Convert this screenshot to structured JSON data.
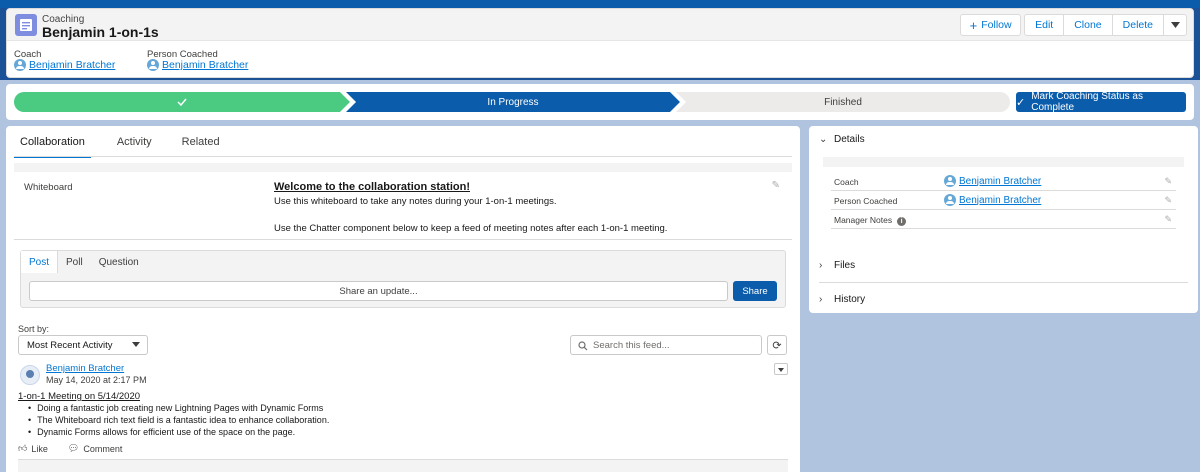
{
  "header": {
    "object_type": "Coaching",
    "title": "Benjamin 1-on-1s",
    "follow_label": "Follow",
    "actions": [
      "Edit",
      "Clone",
      "Delete"
    ],
    "fields": [
      {
        "label": "Coach",
        "value": "Benjamin Bratcher"
      },
      {
        "label": "Person Coached",
        "value": "Benjamin Bratcher"
      }
    ]
  },
  "path": {
    "stages": [
      {
        "label": "",
        "status": "complete"
      },
      {
        "label": "In Progress",
        "status": "current"
      },
      {
        "label": "Finished",
        "status": "future"
      }
    ],
    "mark_button": "Mark Coaching Status as Complete"
  },
  "tabs": [
    "Collaboration",
    "Activity",
    "Related"
  ],
  "whiteboard": {
    "label": "Whiteboard",
    "title": "Welcome to the collaboration station!",
    "line1": "Use this whiteboard to take any notes during your 1-on-1 meetings.",
    "line2": "Use the Chatter component below to keep a feed of meeting notes after each 1-on-1 meeting."
  },
  "publisher": {
    "tabs": [
      "Post",
      "Poll",
      "Question"
    ],
    "placeholder": "Share an update...",
    "share_label": "Share"
  },
  "feed": {
    "sort_label": "Sort by:",
    "sort_value": "Most Recent Activity",
    "search_placeholder": "Search this feed...",
    "post": {
      "author": "Benjamin Bratcher",
      "date": "May 14, 2020 at 2:17 PM",
      "heading": "1-on-1 Meeting on 5/14/2020",
      "bullets": [
        "Doing a fantastic job creating new Lightning Pages with Dynamic Forms",
        "The Whiteboard rich text field is a fantastic idea to enhance collaboration.",
        "Dynamic Forms allows for efficient use of the space on the page."
      ],
      "like_label": "Like",
      "comment_label": "Comment"
    }
  },
  "details": {
    "title": "Details",
    "rows": [
      {
        "label": "Coach",
        "value": "Benjamin Bratcher"
      },
      {
        "label": "Person Coached",
        "value": "Benjamin Bratcher"
      },
      {
        "label": "Manager Notes",
        "value": ""
      }
    ],
    "sections": [
      "Files",
      "History"
    ]
  }
}
